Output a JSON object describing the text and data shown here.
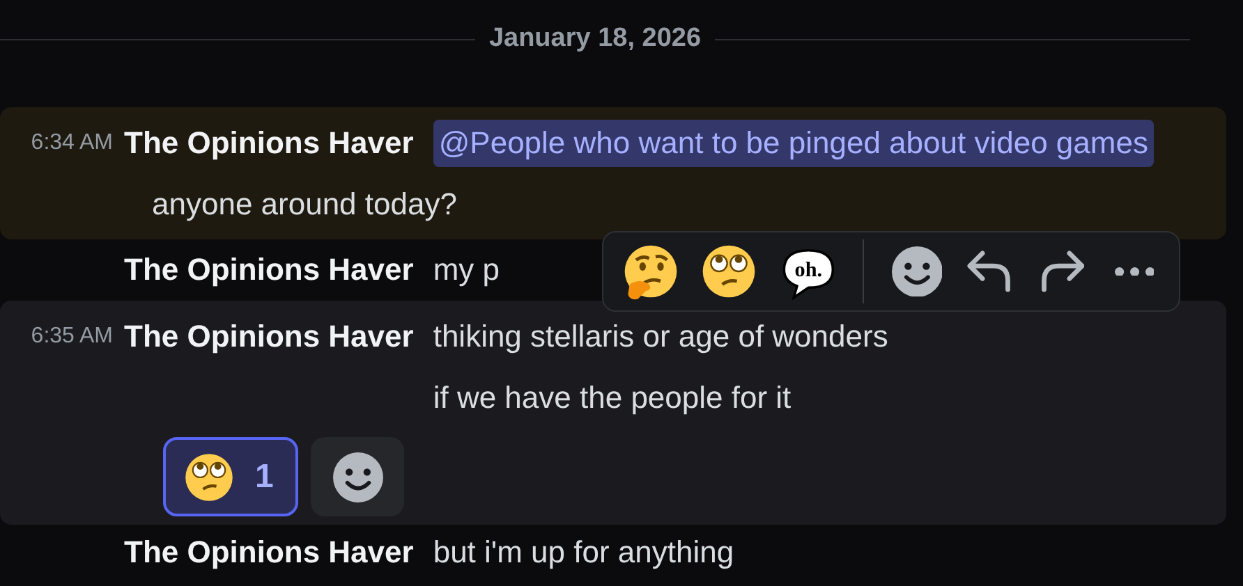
{
  "date_divider": "January 18, 2026",
  "messages": [
    {
      "time": "6:34 AM",
      "author": "The Opinions Haver",
      "mention": "@People who want to be pinged about video games",
      "text": "anyone around today?",
      "highlighted": true,
      "hovered": false
    },
    {
      "author": "The Opinions Haver",
      "text": "my p",
      "highlighted": false,
      "hovered": false
    },
    {
      "time": "6:35 AM",
      "author": "The Opinions Haver",
      "text": "thiking stellaris or age of wonders if we have the people for it",
      "highlighted": false,
      "hovered": true,
      "reactions": [
        {
          "kind": "rolling-eyes",
          "count": "1",
          "selected": true
        }
      ],
      "add_reaction_button": true
    },
    {
      "author": "The Opinions Haver",
      "text": "but i'm up for anything",
      "highlighted": false,
      "hovered": false
    }
  ],
  "hover_toolbar": {
    "quick_reactions": [
      {
        "kind": "thinking"
      },
      {
        "kind": "rolling-eyes"
      },
      {
        "kind": "bubble",
        "label": "oh."
      }
    ],
    "actions": [
      {
        "kind": "add-reaction"
      },
      {
        "kind": "reply"
      },
      {
        "kind": "forward"
      },
      {
        "kind": "more"
      }
    ]
  }
}
